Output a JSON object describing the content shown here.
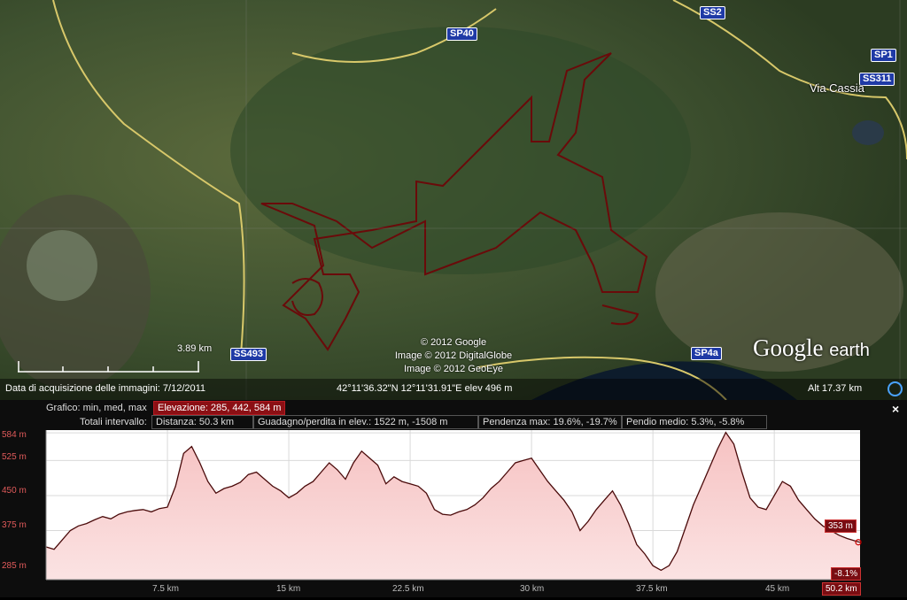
{
  "map": {
    "road_labels": [
      "SS2",
      "SP40",
      "SP1",
      "SS311",
      "SS493",
      "SP4a"
    ],
    "place_labels": [
      "Via Cassia"
    ],
    "copyright_lines": [
      "© 2012 Google",
      "Image © 2012 DigitalGlobe",
      "Image © 2012 GeoEye"
    ],
    "logo": {
      "google": "Google",
      "earth": "earth"
    },
    "scale_label": "3.89 km"
  },
  "status_bar": {
    "acquisition": "Data di acquisizione delle immagini: 7/12/2011",
    "coords": "42°11'36.32\"N   12°11'31.91\"E  elev   496 m",
    "alt": "Alt   17.37 km"
  },
  "profile": {
    "graph_label": "Grafico: min, med, max",
    "elevation": "Elevazione: 285, 442, 584 m",
    "totals_label": "Totali intervallo:",
    "distance": "Distanza: 50.3 km",
    "gain": "Guadagno/perdita in elev.: 1522 m, -1508 m",
    "max_slope": "Pendenza max: 19.6%, -19.7%",
    "avg_slope": "Pendio medio: 5.3%, -5.8%",
    "close": "×",
    "current_elev": "353 m",
    "current_slope": "-8.1%",
    "current_dist": "50.2 km"
  },
  "chart_data": {
    "type": "area",
    "ylim": [
      270,
      590
    ],
    "xlim": [
      0,
      50.3
    ],
    "y_ticks": [
      "584 m",
      "525 m",
      "450 m",
      "375 m",
      "285 m"
    ],
    "y_tick_values": [
      584,
      525,
      450,
      375,
      285
    ],
    "x_ticks": [
      "7.5 km",
      "15 km",
      "22.5 km",
      "30 km",
      "37.5 km",
      "45 km"
    ],
    "x_tick_values": [
      7.5,
      15,
      22.5,
      30,
      37.5,
      45
    ],
    "x": [
      0,
      0.5,
      1,
      1.5,
      2,
      2.5,
      3,
      3.5,
      4,
      4.5,
      5,
      5.5,
      6,
      6.5,
      7,
      7.5,
      8,
      8.5,
      9,
      9.5,
      10,
      10.5,
      11,
      11.5,
      12,
      12.5,
      13,
      13.5,
      14,
      14.5,
      15,
      15.5,
      16,
      16.5,
      17,
      17.5,
      18,
      18.5,
      19,
      19.5,
      20,
      20.5,
      21,
      21.5,
      22,
      22.5,
      23,
      23.5,
      24,
      24.5,
      25,
      25.5,
      26,
      26.5,
      27,
      27.5,
      28,
      28.5,
      29,
      29.5,
      30,
      30.5,
      31,
      31.5,
      32,
      32.5,
      33,
      33.5,
      34,
      34.5,
      35,
      35.5,
      36,
      36.5,
      37,
      37.5,
      38,
      38.5,
      39,
      39.5,
      40,
      40.5,
      41,
      41.5,
      42,
      42.5,
      43,
      43.5,
      44,
      44.5,
      45,
      45.5,
      46,
      46.5,
      47,
      47.5,
      48,
      48.5,
      49,
      49.5,
      50,
      50.3
    ],
    "values": [
      340,
      335,
      355,
      375,
      385,
      390,
      398,
      405,
      400,
      410,
      415,
      418,
      420,
      415,
      422,
      425,
      470,
      540,
      555,
      520,
      480,
      455,
      465,
      470,
      478,
      495,
      500,
      485,
      470,
      460,
      445,
      455,
      470,
      480,
      500,
      520,
      505,
      485,
      520,
      545,
      530,
      515,
      475,
      490,
      480,
      475,
      470,
      455,
      420,
      410,
      408,
      415,
      420,
      430,
      445,
      465,
      480,
      500,
      520,
      525,
      530,
      505,
      480,
      460,
      440,
      415,
      375,
      395,
      420,
      440,
      460,
      430,
      390,
      345,
      325,
      300,
      290,
      300,
      330,
      380,
      430,
      470,
      510,
      550,
      585,
      560,
      500,
      445,
      425,
      420,
      450,
      480,
      470,
      440,
      420,
      400,
      385,
      375,
      365,
      358,
      353,
      350
    ]
  }
}
